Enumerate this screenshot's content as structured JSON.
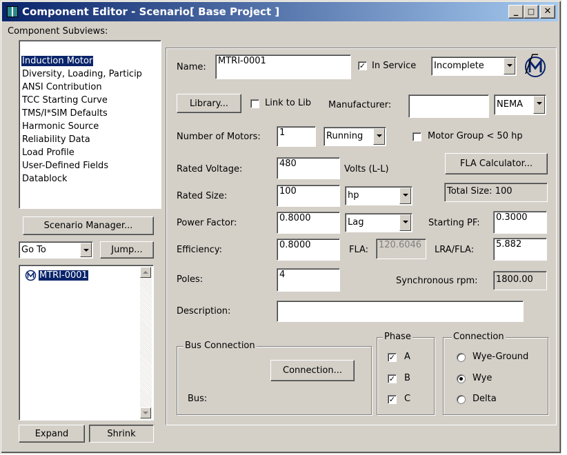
{
  "window": {
    "title": "Component Editor  - Scenario[ Base Project ]",
    "minimize_glyph": "_",
    "maximize_glyph": "□",
    "close_glyph": "✕"
  },
  "left": {
    "subviews_label": "Component Subviews:",
    "subviews": [
      "Induction Motor",
      "Diversity, Loading, Particip",
      "ANSI Contribution",
      "TCC Starting Curve",
      "TMS/I*SIM Defaults",
      "Harmonic Source",
      "Reliability Data",
      "Load Profile",
      "User-Defined Fields",
      "Datablock"
    ],
    "scenario_manager_label": "Scenario Manager...",
    "goto_value": "Go To",
    "jump_label": "Jump...",
    "components": [
      "MTRI-0001"
    ],
    "expand_label": "Expand",
    "shrink_label": "Shrink"
  },
  "form": {
    "name_label": "Name:",
    "name_value": "MTRI-0001",
    "in_service_label": "In Service",
    "in_service_checked": true,
    "status_value": "Incomplete",
    "library_label": "Library...",
    "link_to_lib_label": "Link to Lib",
    "manufacturer_label": "Manufacturer:",
    "manufacturer_value": "",
    "standard_value": "NEMA",
    "num_motors_label": "Number of Motors:",
    "num_motors_value": "1",
    "running_value": "Running",
    "motor_group_label": "Motor Group < 50 hp",
    "rated_voltage_label": "Rated Voltage:",
    "rated_voltage_value": "480",
    "volts_unit": "Volts (L-L)",
    "fla_calc_label": "FLA Calculator...",
    "rated_size_label": "Rated Size:",
    "rated_size_value": "100",
    "size_unit": "hp",
    "total_size": "Total Size: 100",
    "power_factor_label": "Power Factor:",
    "power_factor_value": "0.8000",
    "pf_type": "Lag",
    "starting_pf_label": "Starting PF:",
    "starting_pf_value": "0.3000",
    "efficiency_label": "Efficiency:",
    "efficiency_value": "0.8000",
    "fla_label": "FLA:",
    "fla_value": "120.6046",
    "lra_fla_label": "LRA/FLA:",
    "lra_fla_value": "5.882",
    "poles_label": "Poles:",
    "poles_value": "4",
    "sync_rpm_label": "Synchronous rpm:",
    "sync_rpm_value": "1800.00",
    "description_label": "Description:",
    "description_value": "",
    "bus_connection_title": "Bus Connection",
    "connection_button_label": "Connection...",
    "bus_label": "Bus:",
    "phase_title": "Phase",
    "phases": [
      {
        "label": "A",
        "checked": true
      },
      {
        "label": "B",
        "checked": true
      },
      {
        "label": "C",
        "checked": true
      }
    ],
    "connection_title": "Connection",
    "connections": [
      {
        "label": "Wye-Ground",
        "selected": false
      },
      {
        "label": "Wye",
        "selected": true
      },
      {
        "label": "Delta",
        "selected": false
      }
    ]
  }
}
